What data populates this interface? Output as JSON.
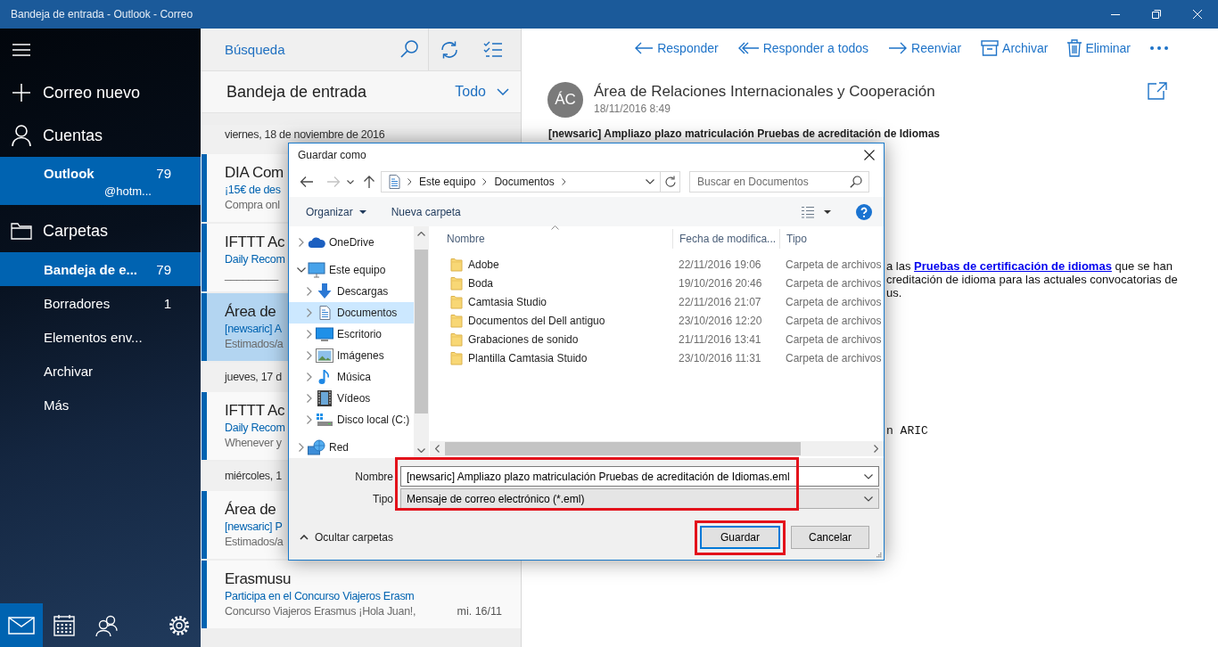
{
  "window": {
    "title": "Bandeja de entrada - Outlook - Correo"
  },
  "sidebar": {
    "new_mail": "Correo nuevo",
    "accounts_label": "Cuentas",
    "accounts": [
      {
        "name": "Outlook",
        "count": "79",
        "address": "@hotm...",
        "selected": true
      }
    ],
    "folders_label": "Carpetas",
    "folders": [
      {
        "name": "Bandeja de e...",
        "count": "79",
        "selected": true
      },
      {
        "name": "Borradores",
        "count": "1",
        "selected": false
      },
      {
        "name": "Elementos env...",
        "selected": false
      },
      {
        "name": "Archivar",
        "selected": false
      },
      {
        "name": "Más",
        "selected": false
      }
    ],
    "bottom_nav": [
      {
        "kind": "mail",
        "selected": true
      },
      {
        "kind": "calendar",
        "selected": false
      },
      {
        "kind": "people",
        "selected": false
      },
      {
        "kind": "settings",
        "selected": false
      }
    ]
  },
  "message_list": {
    "search": {
      "placeholder": "Búsqueda"
    },
    "folder_title": "Bandeja de entrada",
    "filter": "Todo",
    "groups": [
      {
        "date": "viernes, 18 de noviembre de 2016",
        "messages": [
          {
            "sender": "DIA Com",
            "subject": "¡15€ de des",
            "preview": "Compra onl",
            "unread": true,
            "selected": false
          },
          {
            "sender": "IFTTT Ac",
            "subject": "Daily Recom",
            "preview": "_________",
            "unread": true,
            "selected": false
          },
          {
            "sender": "Área de",
            "subject": "[newsaric] A",
            "preview": "Estimados/a",
            "unread": true,
            "selected": true
          }
        ]
      },
      {
        "date": "jueves, 17 d",
        "messages": [
          {
            "sender": "IFTTT Ac",
            "subject": "Daily Recom",
            "preview": "Whenever y",
            "unread": true,
            "selected": false
          }
        ]
      },
      {
        "date": "miércoles, 1",
        "messages": [
          {
            "sender": "Área de",
            "subject": "[newsaric] P",
            "preview": "Estimados/a",
            "unread": true,
            "selected": false
          },
          {
            "sender": "Erasmusu",
            "subject": "Participa en el Concurso Viajeros Erasm",
            "preview": "Concurso Viajeros Erasmus ¡Hola Juan!,",
            "date": "mi. 16/11",
            "unread": true,
            "selected": false
          }
        ]
      }
    ]
  },
  "reading_pane": {
    "actions": [
      {
        "kind": "reply",
        "label": "Responder"
      },
      {
        "kind": "reply_all",
        "label": "Responder a todos"
      },
      {
        "kind": "forward",
        "label": "Reenviar"
      },
      {
        "kind": "archive",
        "label": "Archivar"
      },
      {
        "kind": "delete",
        "label": "Eliminar"
      },
      {
        "kind": "more"
      }
    ],
    "sender_initials": "ÁC",
    "sender": "Área de Relaciones Internacionales y Cooperación",
    "date": "18/11/2016 8:49",
    "subject": "[newsaric] Ampliazo plazo matriculación Pruebas de acreditación de Idiomas",
    "body_lines": [
      {
        "text": "a las",
        "link": "Pruebas de certificación de idiomas",
        "after": "que se han"
      },
      {
        "text": "creditación de idioma para las actuales convocatorias de"
      },
      {
        "text": "us."
      }
    ],
    "signature_fragment": "n ARIC"
  },
  "save_dialog": {
    "title": "Guardar como",
    "nav_buttons": [
      {
        "kind": "back",
        "disabled": false
      },
      {
        "kind": "forward",
        "disabled": true
      },
      {
        "kind": "recent",
        "disabled": false
      },
      {
        "kind": "up",
        "disabled": false
      }
    ],
    "breadcrumb": [
      "Este equipo",
      "Documentos"
    ],
    "search": {
      "placeholder": "Buscar en Documentos"
    },
    "organize": "Organizar",
    "new_folder": "Nueva carpeta",
    "tree": [
      {
        "label": "OneDrive",
        "kind": "cloud",
        "expanded": false,
        "selected": false
      },
      {
        "label": "Este equipo",
        "kind": "computer",
        "expanded": true,
        "selected": false,
        "children": [
          {
            "label": "Descargas",
            "kind": "downloads",
            "expanded": false,
            "selected": false
          },
          {
            "label": "Documentos",
            "kind": "documents",
            "expanded": false,
            "selected": true
          },
          {
            "label": "Escritorio",
            "kind": "desktop",
            "expanded": false,
            "selected": false
          },
          {
            "label": "Imágenes",
            "kind": "pictures",
            "expanded": false,
            "selected": false
          },
          {
            "label": "Música",
            "kind": "music",
            "expanded": false,
            "selected": false
          },
          {
            "label": "Vídeos",
            "kind": "videos",
            "expanded": false,
            "selected": false
          },
          {
            "label": "Disco local (C:)",
            "kind": "drive",
            "expanded": false,
            "selected": false
          }
        ]
      },
      {
        "label": "Red",
        "kind": "network",
        "expanded": false,
        "selected": false
      }
    ],
    "columns": [
      {
        "label": "Nombre",
        "sorted": true
      },
      {
        "label": "Fecha de modifica...",
        "sorted": false
      },
      {
        "label": "Tipo",
        "sorted": false
      }
    ],
    "files": [
      {
        "name": "Adobe",
        "modified": "22/11/2016 19:06",
        "type": "Carpeta de archivos"
      },
      {
        "name": "Boda",
        "modified": "19/10/2016 20:46",
        "type": "Carpeta de archivos"
      },
      {
        "name": "Camtasia Studio",
        "modified": "22/11/2016 21:07",
        "type": "Carpeta de archivos"
      },
      {
        "name": "Documentos del Dell antiguo",
        "modified": "23/10/2016 12:20",
        "type": "Carpeta de archivos"
      },
      {
        "name": "Grabaciones de sonido",
        "modified": "21/11/2016 13:41",
        "type": "Carpeta de archivos"
      },
      {
        "name": "Plantilla Camtasia Stuido",
        "modified": "23/10/2016 11:31",
        "type": "Carpeta de archivos"
      }
    ],
    "file_name": {
      "label": "Nombre",
      "value": "[newsaric] Ampliazo plazo matriculación Pruebas de acreditación de Idiomas.eml"
    },
    "file_type": {
      "label": "Tipo",
      "value": "Mensaje de correo electrónico (*.eml)"
    },
    "fields_highlighted": true,
    "hide_folders": "Ocultar carpetas",
    "buttons": [
      {
        "kind": "save",
        "label": "Guardar",
        "default": true,
        "highlighted": true
      },
      {
        "kind": "cancel",
        "label": "Cancelar",
        "default": false,
        "highlighted": false
      }
    ]
  }
}
